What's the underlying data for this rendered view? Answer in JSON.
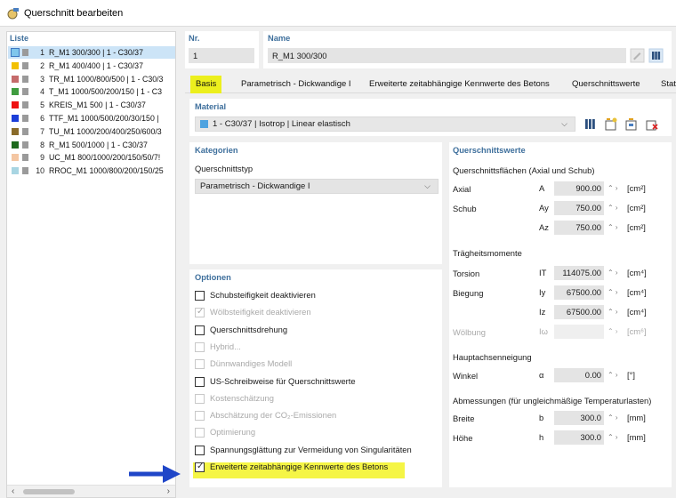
{
  "window": {
    "title": "Querschnitt bearbeiten"
  },
  "list": {
    "header": "Liste",
    "items": [
      {
        "num": "1",
        "name": "R_M1 300/300 | 1 - C30/37",
        "color": "#7fc6ec"
      },
      {
        "num": "2",
        "name": "R_M1 400/400 | 1 - C30/37",
        "color": "#f2c000"
      },
      {
        "num": "3",
        "name": "TR_M1 1000/800/500 | 1 - C30/3",
        "color": "#c56b6b"
      },
      {
        "num": "4",
        "name": "T_M1 1000/500/200/150 | 1 - C3",
        "color": "#3f9c3f"
      },
      {
        "num": "5",
        "name": "KREIS_M1 500 | 1 - C30/37",
        "color": "#ee1111"
      },
      {
        "num": "6",
        "name": "TTF_M1 1000/500/200/30/150 |",
        "color": "#1c3ed8"
      },
      {
        "num": "7",
        "name": "TU_M1 1000/200/400/250/600/3",
        "color": "#8a6b2a"
      },
      {
        "num": "8",
        "name": "R_M1 500/1000 | 1 - C30/37",
        "color": "#1e6a1e"
      },
      {
        "num": "9",
        "name": "UC_M1 800/1000/200/150/50/7!",
        "color": "#f4c6a2"
      },
      {
        "num": "10",
        "name": "RROC_M1 1000/800/200/150/25",
        "color": "#a8d5e2"
      }
    ]
  },
  "header": {
    "nr_label": "Nr.",
    "nr_value": "1",
    "name_label": "Name",
    "name_value": "R_M1 300/300"
  },
  "tabs": [
    "Basis",
    "Parametrisch - Dickwandige I",
    "Erweiterte zeitabhängige Kennwerte des Betons",
    "Querschnittswerte",
    "Stati"
  ],
  "material": {
    "label": "Material",
    "value": "1 - C30/37 | Isotrop | Linear elastisch",
    "color": "#4fa3e0"
  },
  "kategorien": {
    "label": "Kategorien",
    "typ_label": "Querschnittstyp",
    "typ_value": "Parametrisch - Dickwandige I"
  },
  "optionen": {
    "label": "Optionen",
    "items": [
      {
        "label": "Schubsteifigkeit deaktivieren",
        "checked": false,
        "enabled": true
      },
      {
        "label": "Wölbsteifigkeit deaktivieren",
        "checked": true,
        "enabled": false
      },
      {
        "label": "Querschnittsdrehung",
        "checked": false,
        "enabled": true
      },
      {
        "label": "Hybrid...",
        "checked": false,
        "enabled": false
      },
      {
        "label": "Dünnwandiges Modell",
        "checked": false,
        "enabled": false
      },
      {
        "label": "US-Schreibweise für Querschnittswerte",
        "checked": false,
        "enabled": true
      },
      {
        "label": "Kostenschätzung",
        "checked": false,
        "enabled": false
      },
      {
        "label": "Abschätzung der CO₂-Emissionen",
        "checked": false,
        "enabled": false
      },
      {
        "label": "Optimierung",
        "checked": false,
        "enabled": false
      },
      {
        "label": "Spannungsglättung zur Vermeidung von Singularitäten",
        "checked": false,
        "enabled": true
      },
      {
        "label": "Erweiterte zeitabhängige Kennwerte des Betons",
        "checked": true,
        "enabled": true
      }
    ]
  },
  "qw": {
    "label": "Querschnittswerte",
    "flaechen_label": "Querschnittsflächen (Axial und Schub)",
    "axial": {
      "label": "Axial",
      "sym": "A",
      "value": "900.00",
      "unit": "[cm²]"
    },
    "schub": {
      "label": "Schub",
      "sym": "Ay",
      "value": "750.00",
      "unit": "[cm²]"
    },
    "schub_z": {
      "sym": "Az",
      "value": "750.00",
      "unit": "[cm²]"
    },
    "traeg_label": "Trägheitsmomente",
    "torsion": {
      "label": "Torsion",
      "sym": "IT",
      "value": "114075.00",
      "unit": "[cm⁴]"
    },
    "biegung": {
      "label": "Biegung",
      "sym": "Iy",
      "value": "67500.00",
      "unit": "[cm⁴]"
    },
    "biegung_z": {
      "sym": "Iz",
      "value": "67500.00",
      "unit": "[cm⁴]"
    },
    "woelbung": {
      "label": "Wölbung",
      "sym": "Iω",
      "value": "",
      "unit": "[cm⁶]"
    },
    "haupt_label": "Hauptachsenneigung",
    "winkel": {
      "label": "Winkel",
      "sym": "α",
      "value": "0.00",
      "unit": "[°]"
    },
    "abm_label": "Abmessungen (für ungleichmäßige Temperaturlasten)",
    "breite": {
      "label": "Breite",
      "sym": "b",
      "value": "300.0",
      "unit": "[mm]"
    },
    "hoehe": {
      "label": "Höhe",
      "sym": "h",
      "value": "300.0",
      "unit": "[mm]"
    }
  },
  "colors": {
    "accent": "#3e6f9c",
    "highlight": "#ecef1d",
    "arrow": "#1f46c8"
  }
}
